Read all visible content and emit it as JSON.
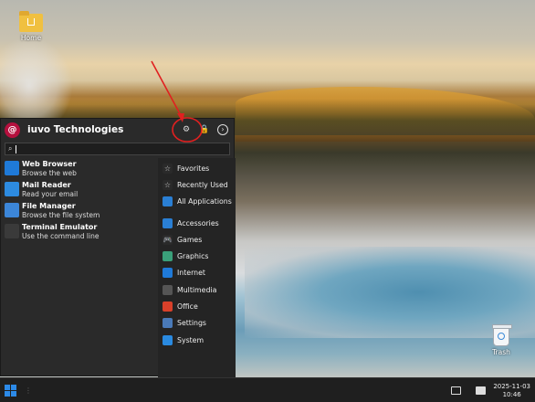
{
  "desktop": {
    "home_label": "Home",
    "trash_label": "Trash"
  },
  "menu": {
    "title": "iuvo Technologies",
    "search_placeholder": "",
    "favorites": [
      {
        "name": "Web Browser",
        "desc": "Browse the web",
        "icon": "edge-browser-icon",
        "color": "#1f7ad8"
      },
      {
        "name": "Mail Reader",
        "desc": "Read your email",
        "icon": "mail-icon",
        "color": "#2d8be0"
      },
      {
        "name": "File Manager",
        "desc": "Browse the file system",
        "icon": "file-manager-icon",
        "color": "#3c86d8"
      },
      {
        "name": "Terminal Emulator",
        "desc": "Use the command line",
        "icon": "terminal-icon",
        "color": "#3a3a3a"
      }
    ],
    "categories_top": [
      {
        "label": "Favorites",
        "icon": "star-icon",
        "color": "#2a2a2a"
      },
      {
        "label": "Recently Used",
        "icon": "recent-star-icon",
        "color": "#2a2a2a"
      },
      {
        "label": "All Applications",
        "icon": "all-apps-icon",
        "color": "#2a7fd4"
      }
    ],
    "categories": [
      {
        "label": "Accessories",
        "icon": "accessories-icon",
        "color": "#2a7fd4"
      },
      {
        "label": "Games",
        "icon": "gamepad-icon",
        "color": "#2a2a2a"
      },
      {
        "label": "Graphics",
        "icon": "graphics-icon",
        "color": "#3aa07a"
      },
      {
        "label": "Internet",
        "icon": "globe-icon",
        "color": "#1f7ad8"
      },
      {
        "label": "Multimedia",
        "icon": "multimedia-icon",
        "color": "#555"
      },
      {
        "label": "Office",
        "icon": "office-icon",
        "color": "#d8402a"
      },
      {
        "label": "Settings",
        "icon": "settings-icon",
        "color": "#4a7ab8"
      },
      {
        "label": "System",
        "icon": "system-icon",
        "color": "#2a8ae0"
      }
    ]
  },
  "taskbar": {
    "date": "2025-11-03",
    "time": "10:46"
  },
  "colors": {
    "accent": "#2c8ae8",
    "brand": "#b5103e",
    "annotation": "#e02020"
  }
}
